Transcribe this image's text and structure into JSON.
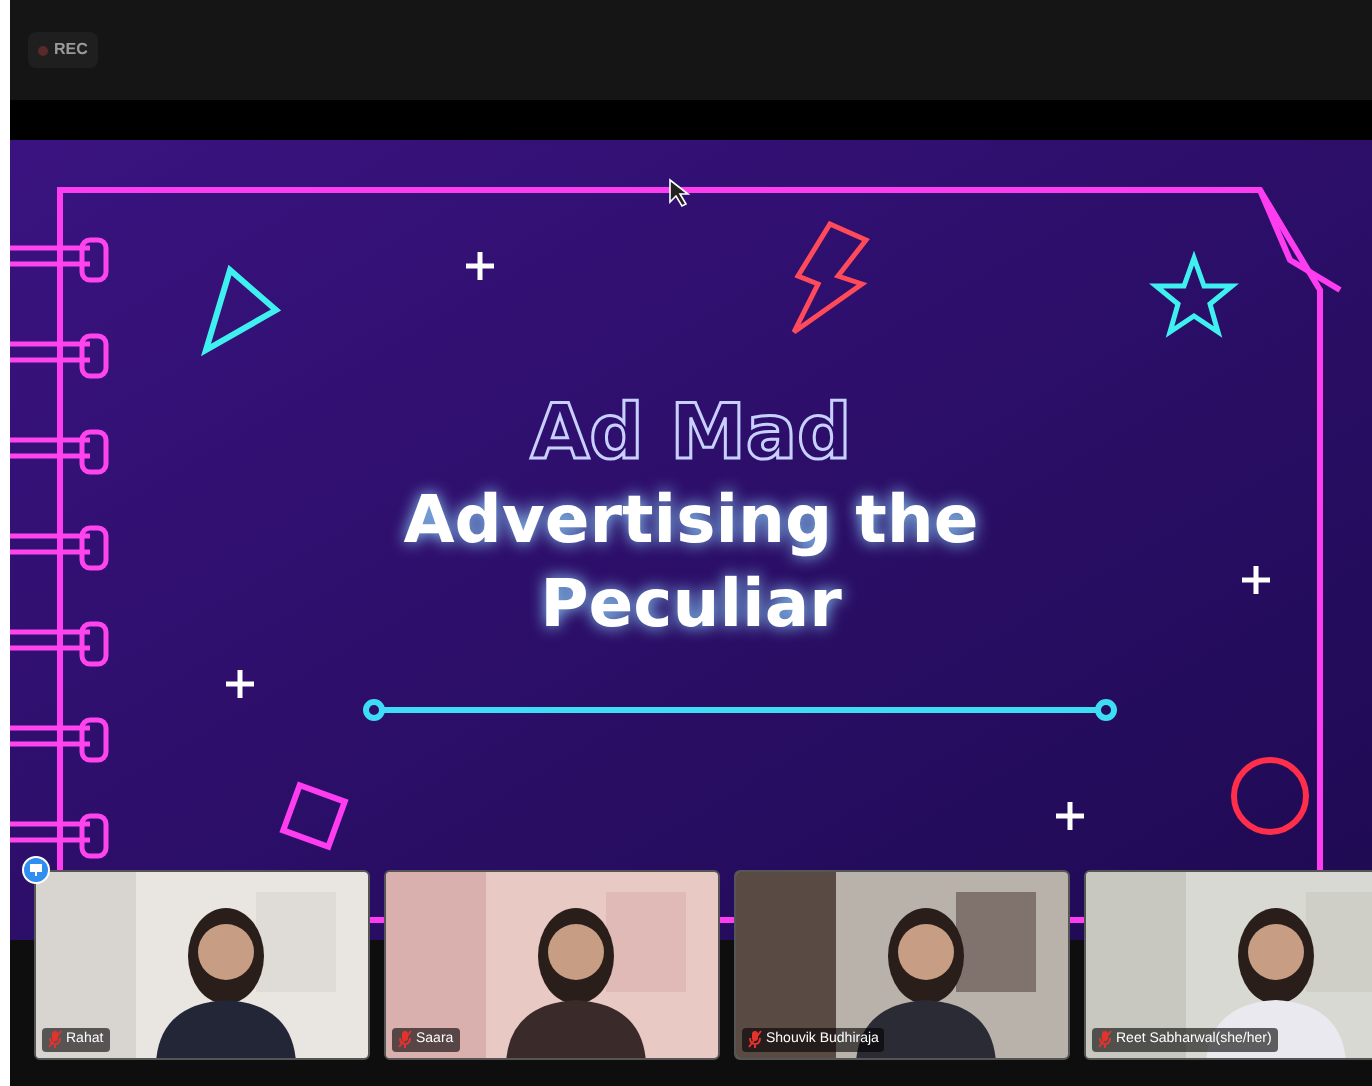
{
  "recording": {
    "label": "REC"
  },
  "slide": {
    "title": "Ad Mad",
    "heading_lines": [
      "Advertising the",
      "Peculiar"
    ]
  },
  "participants": [
    {
      "name": "Rahat",
      "muted": true
    },
    {
      "name": "Saara",
      "muted": true
    },
    {
      "name": "Shouvik Budhiraja",
      "muted": true
    },
    {
      "name": "Reet Sabharwal(she/her)",
      "muted": true
    }
  ]
}
